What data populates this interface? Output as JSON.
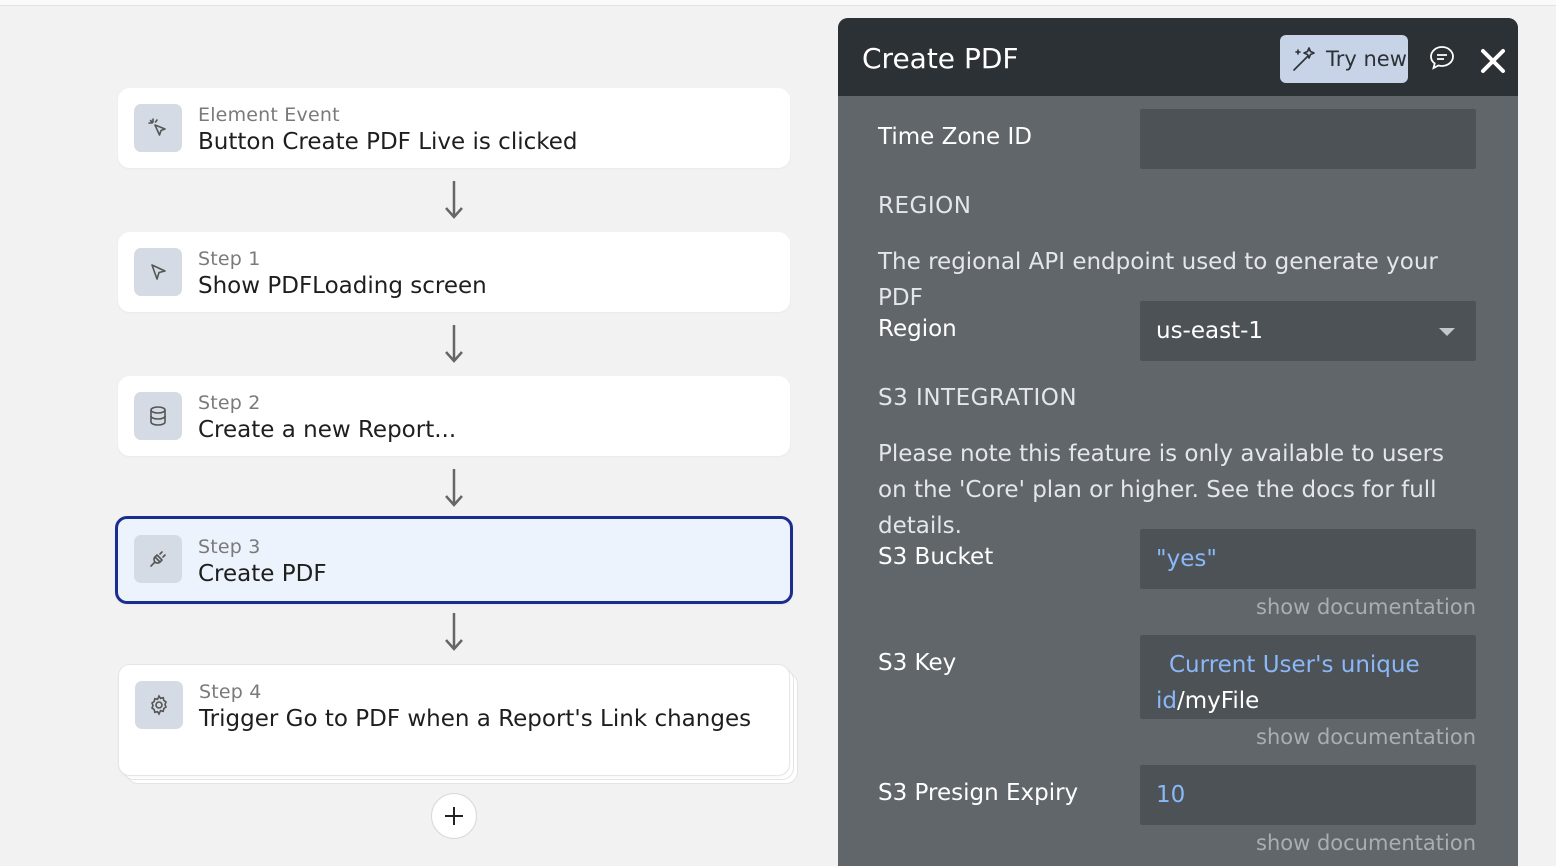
{
  "workflow": {
    "event": {
      "sub": "Element Event",
      "title": "Button Create PDF Live is clicked",
      "icon": "cursor-click-icon"
    },
    "steps": [
      {
        "sub": "Step 1",
        "title": "Show PDFLoading screen",
        "icon": "pointer-icon"
      },
      {
        "sub": "Step 2",
        "title": "Create a new Report...",
        "icon": "database-icon"
      },
      {
        "sub": "Step 3",
        "title": "Create PDF",
        "icon": "plug-icon",
        "selected": true
      },
      {
        "sub": "Step 4",
        "title": "Trigger Go to PDF when a Report's Link changes",
        "icon": "gear-icon"
      }
    ]
  },
  "panel": {
    "title": "Create PDF",
    "try_new_label": "Try new",
    "time_zone_label": "Time Zone ID",
    "time_zone_value": "",
    "region_section": "REGION",
    "region_desc": "The regional API endpoint used to generate your PDF",
    "region_label": "Region",
    "region_value": "us-east-1",
    "s3_section": "S3 INTEGRATION",
    "s3_desc": "Please note this feature is only available to users on the 'Core' plan or higher. See the docs for full details.",
    "s3_bucket_label": "S3 Bucket",
    "s3_bucket_value": "\"yes\"",
    "s3_key_label": "S3 Key",
    "s3_key_dynamic_1": "Current User's unique",
    "s3_key_dynamic_2": "id",
    "s3_key_plain": "/myFile",
    "s3_expiry_label": "S3 Presign Expiry",
    "s3_expiry_value": "10",
    "show_doc": "show documentation"
  },
  "colors": {
    "panel_bg": "#61666b",
    "panel_head": "#2c3136",
    "selected_border": "#1b2e8f",
    "dynamic_text": "#8ab8f8"
  }
}
